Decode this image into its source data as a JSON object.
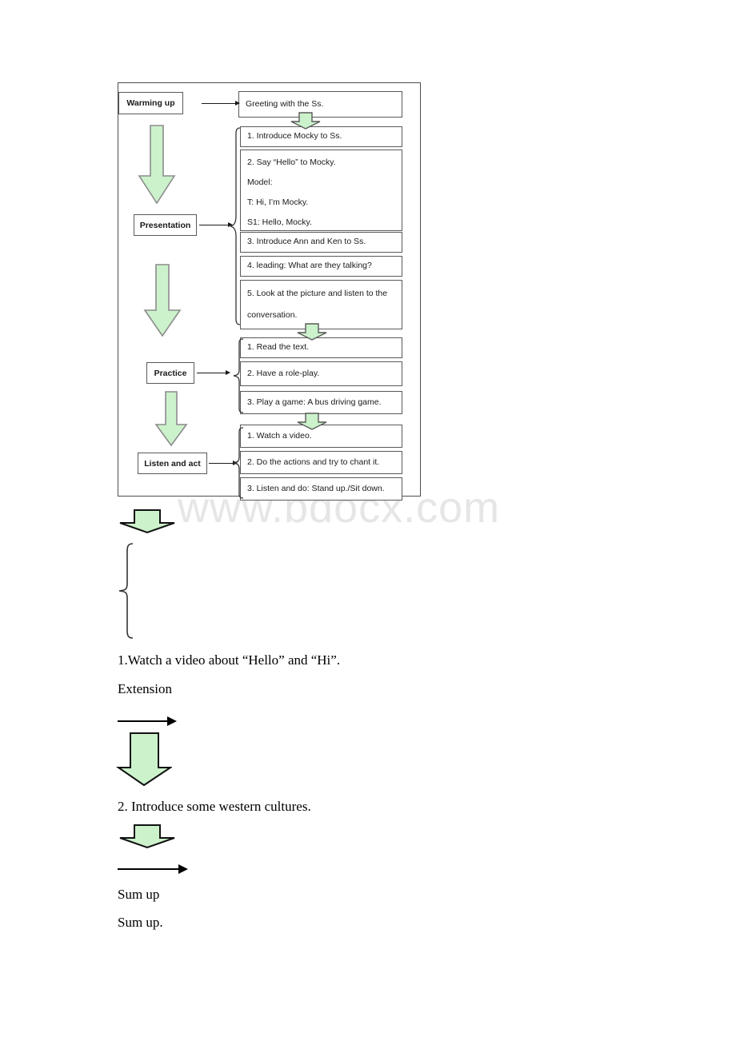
{
  "watermark": {
    "text": "www.bdocx.com"
  },
  "flow": {
    "stages": [
      {
        "id": "warming-up",
        "label": "Warming up"
      },
      {
        "id": "presentation",
        "label": "Presentation"
      },
      {
        "id": "practice",
        "label": "Practice"
      },
      {
        "id": "listen-and-act",
        "label": "Listen and act"
      }
    ],
    "warming_up_items": [
      {
        "lines": [
          "Greeting with the Ss."
        ]
      }
    ],
    "presentation_items": [
      {
        "lines": [
          "1. Introduce Mocky to Ss."
        ]
      },
      {
        "lines": [
          "2. Say “Hello” to Mocky.",
          "Model:",
          "T: Hi, I’m Mocky.",
          "S1: Hello, Mocky."
        ]
      },
      {
        "lines": [
          "3. Introduce Ann and Ken to Ss."
        ]
      },
      {
        "lines": [
          "4. leading: What are they talking?"
        ]
      },
      {
        "lines": [
          "5. Look at the picture and listen to the",
          "conversation."
        ]
      }
    ],
    "practice_items": [
      {
        "lines": [
          "1. Read the text."
        ]
      },
      {
        "lines": [
          "2. Have a role-play."
        ]
      },
      {
        "lines": [
          "3. Play a game: A bus driving game."
        ]
      }
    ],
    "listen_items": [
      {
        "lines": [
          "1. Watch a video."
        ]
      },
      {
        "lines": [
          "2. Do the actions and try to chant it."
        ]
      },
      {
        "lines": [
          "3. Listen and do: Stand up./Sit down."
        ]
      }
    ]
  },
  "body_text": {
    "line1": "1.Watch a video about “Hello” and “Hi”.",
    "line2": "Extension",
    "line3": "2. Introduce some western cultures.",
    "line4": "Sum up",
    "line5": "Sum up."
  },
  "colors": {
    "arrow_fill": "#ccf2cc",
    "arrow_stroke": "#333333",
    "arrow_stroke_light": "#8c8c8c",
    "box_border": "#595959",
    "container_border": "#4d4d4d",
    "text": "#1a1a1a",
    "watermark": "#e6e6e6"
  }
}
